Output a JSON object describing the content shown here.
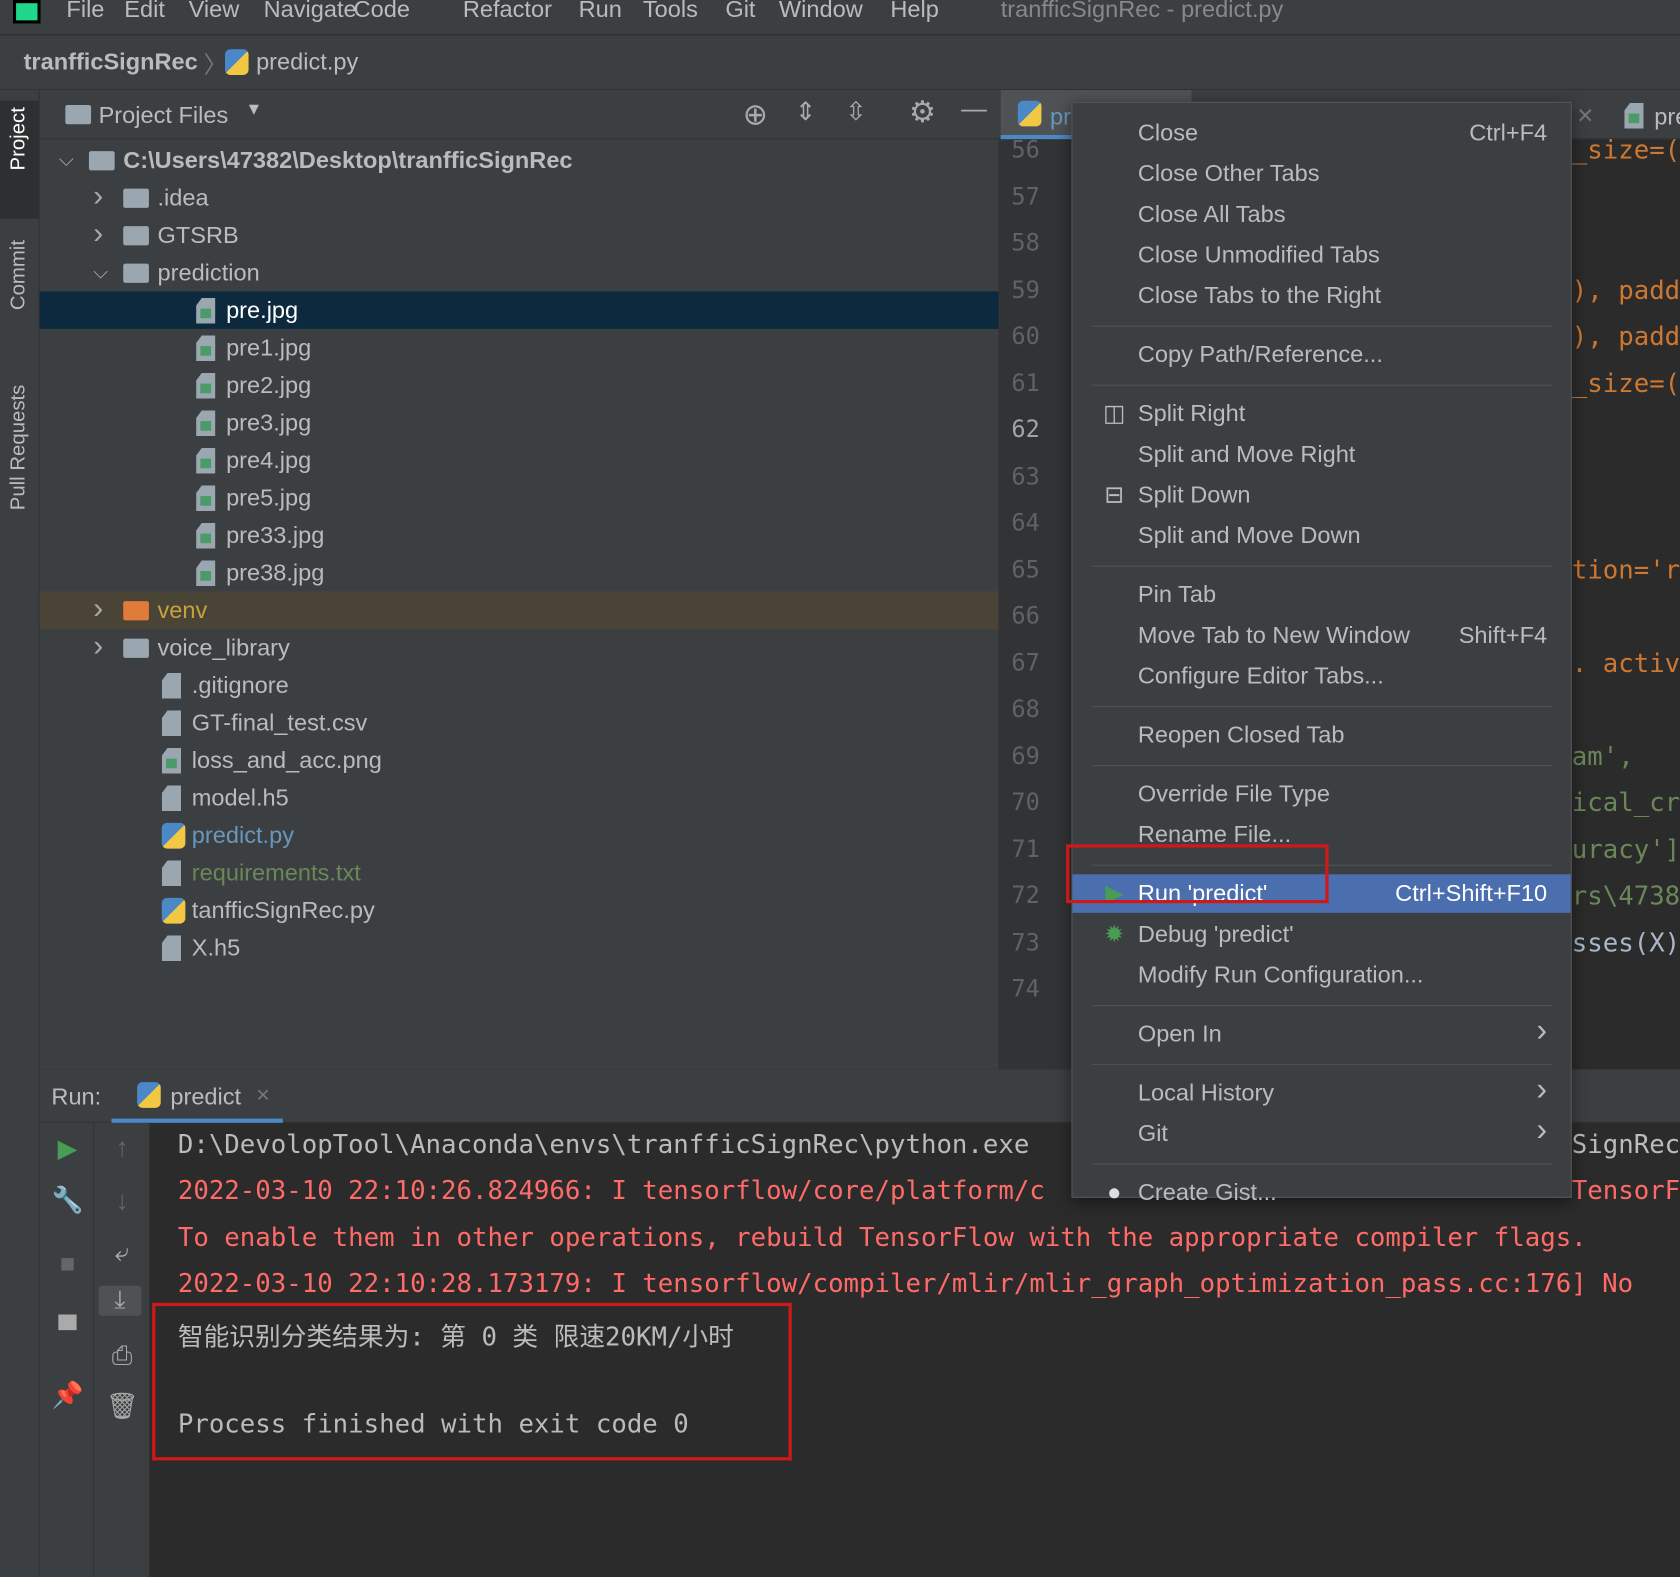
{
  "app": {
    "title": "tranfficSignRec - predict.py",
    "logo_text": "PC"
  },
  "menubar": [
    "File",
    "Edit",
    "View",
    "Navigate",
    "Code",
    "Refactor",
    "Run",
    "Tools",
    "Git",
    "Window",
    "Help"
  ],
  "breadcrumb": {
    "project": "tranfficSignRec",
    "file": "predict.py"
  },
  "toolstrip": [
    "Project",
    "Commit",
    "Pull Requests"
  ],
  "project_panel": {
    "title": "Project Files",
    "tree": [
      {
        "label": "C:\\Users\\47382\\Desktop\\tranfficSignRec",
        "type": "folder",
        "depth": 0,
        "expanded": true,
        "bold": true
      },
      {
        "label": ".idea",
        "type": "folder",
        "depth": 1,
        "expanded": false
      },
      {
        "label": "GTSRB",
        "type": "folder",
        "depth": 1,
        "expanded": false
      },
      {
        "label": "prediction",
        "type": "folder",
        "depth": 1,
        "expanded": true
      },
      {
        "label": "pre.jpg",
        "type": "image",
        "depth": 2,
        "selected": true
      },
      {
        "label": "pre1.jpg",
        "type": "image",
        "depth": 2
      },
      {
        "label": "pre2.jpg",
        "type": "image",
        "depth": 2
      },
      {
        "label": "pre3.jpg",
        "type": "image",
        "depth": 2
      },
      {
        "label": "pre4.jpg",
        "type": "image",
        "depth": 2
      },
      {
        "label": "pre5.jpg",
        "type": "image",
        "depth": 2
      },
      {
        "label": "pre33.jpg",
        "type": "image",
        "depth": 2
      },
      {
        "label": "pre38.jpg",
        "type": "image",
        "depth": 2
      },
      {
        "label": "venv",
        "type": "folder-excluded",
        "depth": 1,
        "expanded": false,
        "color": "#c7a23a"
      },
      {
        "label": "voice_library",
        "type": "folder",
        "depth": 1,
        "expanded": false
      },
      {
        "label": ".gitignore",
        "type": "file",
        "depth": 1
      },
      {
        "label": "GT-final_test.csv",
        "type": "file",
        "depth": 1
      },
      {
        "label": "loss_and_acc.png",
        "type": "image",
        "depth": 1
      },
      {
        "label": "model.h5",
        "type": "file",
        "depth": 1
      },
      {
        "label": "predict.py",
        "type": "python",
        "depth": 1,
        "color": "#6897bb"
      },
      {
        "label": "requirements.txt",
        "type": "file",
        "depth": 1,
        "color": "#6a8759"
      },
      {
        "label": "tanfficSignRec.py",
        "type": "python",
        "depth": 1
      },
      {
        "label": "X.h5",
        "type": "file",
        "depth": 1
      }
    ]
  },
  "editor": {
    "active_tab": "pr",
    "other_tab": "pre",
    "close_glyph": "×",
    "line_numbers": [
      "56",
      "57",
      "58",
      "59",
      "60",
      "61",
      "62",
      "63",
      "64",
      "65",
      "66",
      "67",
      "68",
      "69",
      "70",
      "71",
      "72",
      "73",
      "74"
    ],
    "code_fragments": [
      {
        "line": "56",
        "text": "_size=(",
        "color": "#cc7832"
      },
      {
        "line": "59",
        "text": "), paddi",
        "color": "#cc7832"
      },
      {
        "line": "60",
        "text": "), paddi",
        "color": "#cc7832"
      },
      {
        "line": "61",
        "text": "_size=(",
        "color": "#cc7832"
      },
      {
        "line": "65",
        "text": "tion='r",
        "color": "#cc7832"
      },
      {
        "line": "67",
        "text": ". activa",
        "color": "#cc7832"
      },
      {
        "line": "69",
        "text": "am',",
        "color": "#6a8759"
      },
      {
        "line": "70",
        "text": "ical_cr",
        "color": "#6a8759"
      },
      {
        "line": "71",
        "text": "uracy']]",
        "color": "#6a8759"
      },
      {
        "line": "72",
        "text": "rs\\4738",
        "color": "#6a8759"
      },
      {
        "line": "73",
        "text": "sses(X)",
        "color": "#a9b7c6"
      }
    ]
  },
  "run_panel": {
    "label": "Run:",
    "tab": "predict",
    "console": [
      {
        "text": "D:\\DevolopTool\\Anaconda\\envs\\tranfficSignRec\\python.exe",
        "tail": "SignRec",
        "style": "normal"
      },
      {
        "text": "2022-03-10 22:10:26.824966: I tensorflow/core/platform/c",
        "tail": "TensorFl",
        "style": "error"
      },
      {
        "text": "To enable them in other operations, rebuild TensorFlow with the appropriate compiler flags.",
        "style": "error"
      },
      {
        "text": "2022-03-10 22:10:28.173179: I tensorflow/compiler/mlir/mlir_graph_optimization_pass.cc:176] No",
        "style": "error"
      },
      {
        "text": "智能识别分类结果为: 第 0 类 限速20KM/小时",
        "style": "normal"
      },
      {
        "text": "Process finished with exit code 0",
        "style": "normal"
      }
    ]
  },
  "context_menu": {
    "groups": [
      [
        {
          "label": "Close",
          "shortcut": "Ctrl+F4"
        },
        {
          "label": "Close Other Tabs"
        },
        {
          "label": "Close All Tabs"
        },
        {
          "label": "Close Unmodified Tabs"
        },
        {
          "label": "Close Tabs to the Right"
        }
      ],
      [
        {
          "label": "Copy Path/Reference..."
        }
      ],
      [
        {
          "label": "Split Right",
          "icon": "split-vertical-icon"
        },
        {
          "label": "Split and Move Right"
        },
        {
          "label": "Split Down",
          "icon": "split-horizontal-icon"
        },
        {
          "label": "Split and Move Down"
        }
      ],
      [
        {
          "label": "Pin Tab"
        },
        {
          "label": "Move Tab to New Window",
          "shortcut": "Shift+F4"
        },
        {
          "label": "Configure Editor Tabs..."
        }
      ],
      [
        {
          "label": "Reopen Closed Tab"
        }
      ],
      [
        {
          "label": "Override File Type"
        },
        {
          "label": "Rename File..."
        }
      ],
      [
        {
          "label": "Run 'predict'",
          "shortcut": "Ctrl+Shift+F10",
          "icon": "run-icon",
          "highlighted": true
        },
        {
          "label": "Debug 'predict'",
          "icon": "debug-icon"
        },
        {
          "label": "Modify Run Configuration..."
        }
      ],
      [
        {
          "label": "Open In",
          "submenu": true
        }
      ],
      [
        {
          "label": "Local History",
          "submenu": true
        },
        {
          "label": "Git",
          "submenu": true
        }
      ],
      [
        {
          "label": "Create Gist...",
          "icon": "github-icon"
        }
      ]
    ]
  },
  "colors": {
    "highlight": "#4b6eaf",
    "selection": "#0d293e",
    "error_text": "#ff6b68",
    "annotation_box": "#d01818",
    "run_green": "#499c54"
  }
}
